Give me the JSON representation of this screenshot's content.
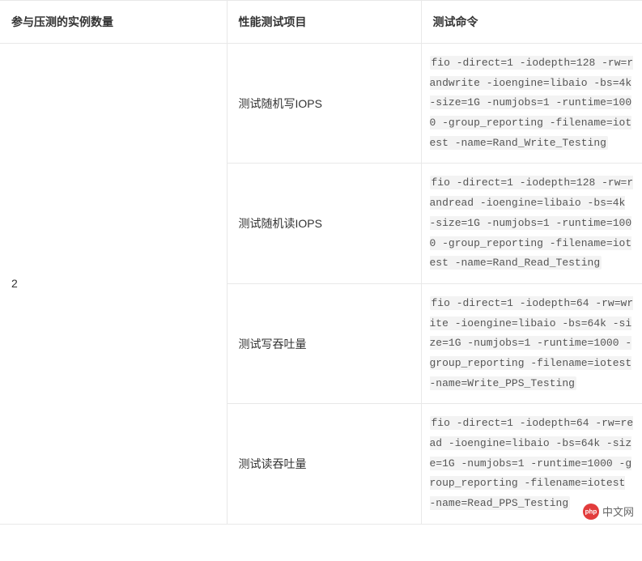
{
  "table": {
    "headers": [
      "参与压测的实例数量",
      "性能测试项目",
      "测试命令"
    ],
    "instance_count": "2",
    "rows": [
      {
        "project": "测试随机写IOPS",
        "command": "fio -direct=1 -iodepth=128 -rw=randwrite -ioengine=libaio -bs=4k -size=1G -numjobs=1 -runtime=1000 -group_reporting -filename=iotest -name=Rand_Write_Testing"
      },
      {
        "project": "测试随机读IOPS",
        "command": "fio -direct=1 -iodepth=128 -rw=randread -ioengine=libaio -bs=4k -size=1G -numjobs=1 -runtime=1000 -group_reporting -filename=iotest -name=Rand_Read_Testing"
      },
      {
        "project": "测试写吞吐量",
        "command": "fio -direct=1 -iodepth=64 -rw=write -ioengine=libaio -bs=64k -size=1G -numjobs=1 -runtime=1000 -group_reporting -filename=iotest -name=Write_PPS_Testing"
      },
      {
        "project": "测试读吞吐量",
        "command": "fio -direct=1 -iodepth=64 -rw=read -ioengine=libaio -bs=64k -size=1G -numjobs=1 -runtime=1000 -group_reporting -filename=iotest -name=Read_PPS_Testing"
      }
    ]
  },
  "watermark": {
    "text": "中文网"
  }
}
